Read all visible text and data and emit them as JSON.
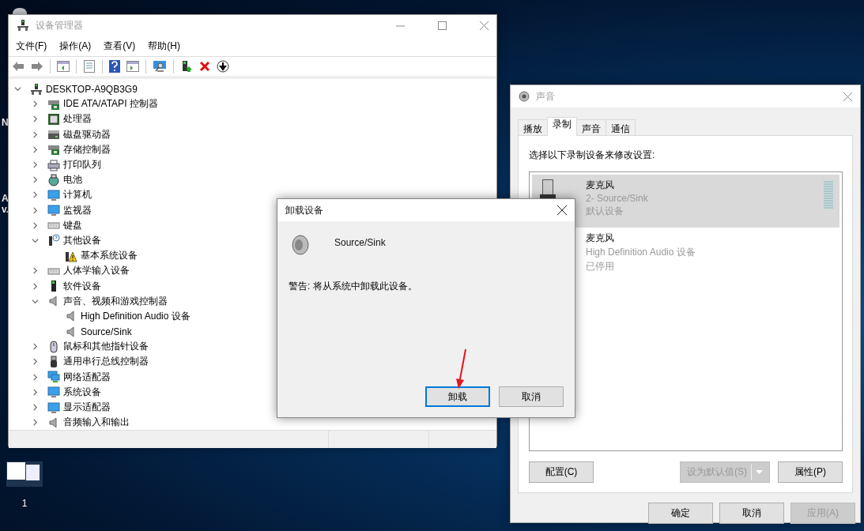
{
  "desktop": {
    "edge_labels": [
      "N",
      "A",
      "v."
    ],
    "thumbnail_label": "1"
  },
  "device_manager": {
    "title": "设备管理器",
    "menu": [
      "文件(F)",
      "操作(A)",
      "查看(V)",
      "帮助(H)"
    ],
    "tree": {
      "label": "DESKTOP-A9QB3G9",
      "kind": "computer",
      "expanded": true,
      "children": [
        {
          "label": "IDE ATA/ATAPI 控制器",
          "kind": "controller",
          "expanded": false
        },
        {
          "label": "处理器",
          "kind": "chip",
          "expanded": false
        },
        {
          "label": "磁盘驱动器",
          "kind": "drive",
          "expanded": false
        },
        {
          "label": "存储控制器",
          "kind": "controller",
          "expanded": false
        },
        {
          "label": "打印队列",
          "kind": "printer",
          "expanded": false
        },
        {
          "label": "电池",
          "kind": "battery",
          "expanded": false
        },
        {
          "label": "计算机",
          "kind": "monitor",
          "expanded": false
        },
        {
          "label": "监视器",
          "kind": "monitor",
          "expanded": false
        },
        {
          "label": "键盘",
          "kind": "keyboard",
          "expanded": false
        },
        {
          "label": "其他设备",
          "kind": "unknown",
          "expanded": true,
          "children": [
            {
              "label": "基本系统设备",
              "kind": "warning"
            }
          ]
        },
        {
          "label": "人体学输入设备",
          "kind": "keyboard",
          "expanded": false
        },
        {
          "label": "软件设备",
          "kind": "device",
          "expanded": false
        },
        {
          "label": "声音、视频和游戏控制器",
          "kind": "audio",
          "expanded": true,
          "children": [
            {
              "label": "High Definition Audio 设备",
              "kind": "audio"
            },
            {
              "label": "Source/Sink",
              "kind": "audio"
            }
          ]
        },
        {
          "label": "鼠标和其他指针设备",
          "kind": "mouse",
          "expanded": false
        },
        {
          "label": "通用串行总线控制器",
          "kind": "usb",
          "expanded": false
        },
        {
          "label": "网络适配器",
          "kind": "network",
          "expanded": false
        },
        {
          "label": "系统设备",
          "kind": "monitor",
          "expanded": false
        },
        {
          "label": "显示适配器",
          "kind": "monitor",
          "expanded": false
        },
        {
          "label": "音频输入和输出",
          "kind": "audio",
          "expanded": false
        }
      ]
    }
  },
  "sound": {
    "title": "声音",
    "tabs": [
      {
        "label": "播放",
        "selected": false
      },
      {
        "label": "录制",
        "selected": true
      },
      {
        "label": "声音",
        "selected": false
      },
      {
        "label": "通信",
        "selected": false
      }
    ],
    "instruction": "选择以下录制设备来修改设置:",
    "devices": [
      {
        "name": "麦克风",
        "description": "2- Source/Sink",
        "status": "默认设备",
        "selected": true
      },
      {
        "name": "麦克风",
        "description": "High Definition Audio 设备",
        "status": "已停用",
        "selected": false
      }
    ],
    "buttons": [
      {
        "label": "配置(C)",
        "kind": "plain",
        "disabled": false
      },
      {
        "label": "设为默认值(S)",
        "kind": "split",
        "disabled": true
      },
      {
        "label": "属性(P)",
        "kind": "plain",
        "disabled": false
      }
    ],
    "footer_buttons": [
      {
        "label": "确定",
        "disabled": false
      },
      {
        "label": "取消",
        "disabled": false
      },
      {
        "label": "应用(A)",
        "disabled": true
      }
    ]
  },
  "uninstall_dialog": {
    "title": "卸载设备",
    "device": "Source/Sink",
    "warning": "警告: 将从系统中卸载此设备。",
    "buttons": [
      {
        "label": "卸载",
        "default": true
      },
      {
        "label": "取消",
        "default": false
      }
    ]
  }
}
